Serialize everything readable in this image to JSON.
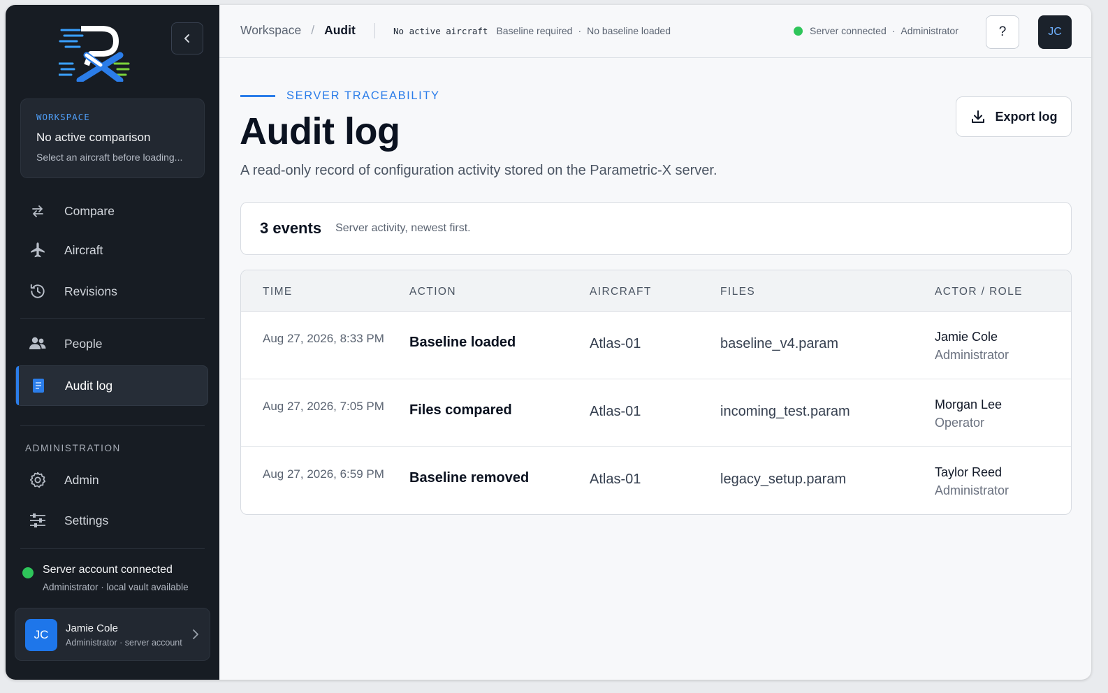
{
  "sidebar": {
    "workspace": {
      "kicker": "WORKSPACE",
      "title": "No active comparison",
      "subtitle": "Select an aircraft before loading..."
    },
    "nav": [
      {
        "label": "Compare",
        "icon": "arrows-swap-icon"
      },
      {
        "label": "Aircraft",
        "icon": "airplane-icon"
      },
      {
        "label": "Revisions",
        "icon": "history-icon"
      },
      {
        "label": "People",
        "icon": "people-icon"
      },
      {
        "label": "Audit log",
        "icon": "document-icon",
        "active": true
      }
    ],
    "admin_section_label": "ADMINISTRATION",
    "admin_nav": [
      {
        "label": "Admin",
        "icon": "gear-icon"
      },
      {
        "label": "Settings",
        "icon": "sliders-icon"
      }
    ],
    "server_status": {
      "title": "Server account connected",
      "detail": "Administrator · local vault available"
    },
    "user": {
      "initials": "JC",
      "name": "Jamie Cole",
      "role": "Administrator · server account"
    }
  },
  "topbar": {
    "breadcrumb_root": "Workspace",
    "breadcrumb_sep": "/",
    "breadcrumb_current": "Audit",
    "aircraft_status": "No active aircraft",
    "baseline_required": "Baseline required",
    "baseline_loaded": "No baseline loaded",
    "server_connected": "Server connected",
    "role": "Administrator",
    "help_label": "?",
    "avatar_initials": "JC"
  },
  "page": {
    "kicker": "SERVER TRACEABILITY",
    "title": "Audit log",
    "subtitle": "A read-only record of configuration activity stored on the Parametric-X server.",
    "export_label": "Export log",
    "summary_count": "3 events",
    "summary_desc": "Server activity, newest first."
  },
  "table": {
    "headers": [
      "TIME",
      "ACTION",
      "AIRCRAFT",
      "FILES",
      "ACTOR / ROLE"
    ],
    "rows": [
      {
        "time": "Aug 27, 2026, 8:33 PM",
        "action": "Baseline loaded",
        "aircraft": "Atlas-01",
        "files": "baseline_v4.param",
        "actor": "Jamie Cole",
        "role": "Administrator"
      },
      {
        "time": "Aug 27, 2026, 7:05 PM",
        "action": "Files compared",
        "aircraft": "Atlas-01",
        "files": "incoming_test.param",
        "actor": "Morgan Lee",
        "role": "Operator"
      },
      {
        "time": "Aug 27, 2026, 6:59 PM",
        "action": "Baseline removed",
        "aircraft": "Atlas-01",
        "files": "legacy_setup.param",
        "actor": "Taylor Reed",
        "role": "Administrator"
      }
    ]
  },
  "colors": {
    "accent": "#2b7de9",
    "sidebar_bg": "#171c23",
    "status_green": "#2ec55a"
  }
}
